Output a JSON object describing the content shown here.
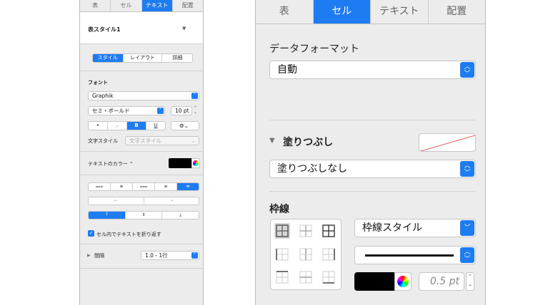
{
  "left": {
    "tabs": [
      "表",
      "セル",
      "テキスト",
      "配置"
    ],
    "selected_tab": "テキスト",
    "style_name": "表スタイル1",
    "subtabs": [
      "スタイル",
      "レイアウト",
      "詳細"
    ],
    "font_label": "フォント",
    "font_family": "Graphik",
    "font_weight": "セミ・ボールド",
    "font_size": "10 pt",
    "style_buttons": [
      "•",
      "⸝",
      "B",
      "U",
      "⚙⌄"
    ],
    "char_style_label": "文字スタイル",
    "char_style_value": "文字スタイル",
    "text_color_label": "テキストのカラー ⌃",
    "wrap_label": "セル内でテキストを折り返す",
    "spacing_label": "間隔",
    "spacing_value": "1.0 - 1行",
    "align_icons": [
      "⩶",
      "≡",
      "⩶",
      "≡",
      "⇹"
    ],
    "indent_icons": [
      "⇤",
      "⇥"
    ],
    "valign_icons": [
      "⤒",
      "⇕",
      "⤓"
    ]
  },
  "right": {
    "tabs": [
      "表",
      "セル",
      "テキスト",
      "配置"
    ],
    "selected_tab": "セル",
    "data_format_label": "データフォーマット",
    "data_format_value": "自動",
    "fill_label": "塗りつぶし",
    "fill_value": "塗りつぶしなし",
    "border_label": "枠線",
    "border_style_value": "枠線スタイル",
    "border_width": "0.5 pt"
  },
  "colors": {
    "accent": "#1e7cf2",
    "text_color_swatch": "#000000",
    "border_color_swatch": "#000000"
  }
}
